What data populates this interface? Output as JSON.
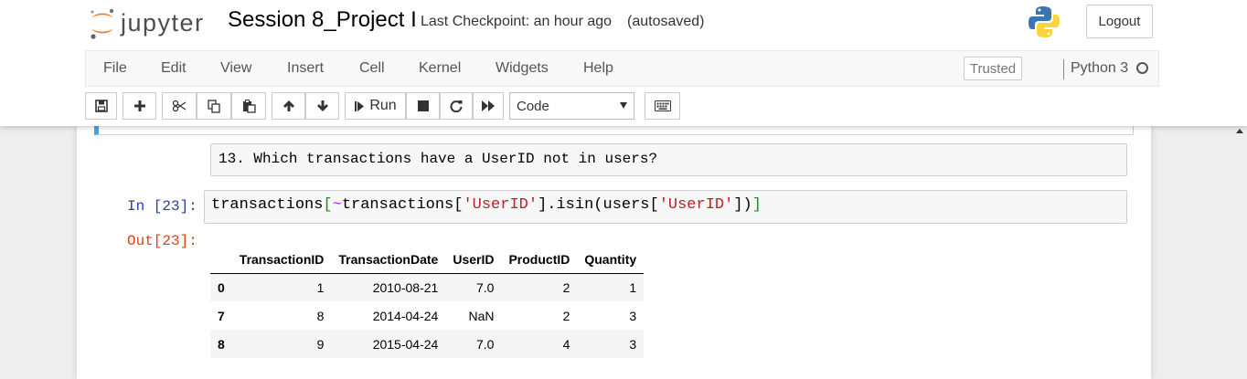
{
  "header": {
    "logo_text": "jupyter",
    "notebook_title": "Session 8_Project I",
    "checkpoint_text": "Last Checkpoint: an hour ago",
    "autosave_text": "(autosaved)",
    "logout_label": "Logout"
  },
  "menubar": {
    "items": [
      "File",
      "Edit",
      "View",
      "Insert",
      "Cell",
      "Kernel",
      "Widgets",
      "Help"
    ],
    "trusted_label": "Trusted",
    "kernel_name": "Python 3"
  },
  "toolbar": {
    "run_label": "Run",
    "cell_type": "Code",
    "icons": [
      "save-icon",
      "plus-icon",
      "cut-icon",
      "copy-icon",
      "paste-icon",
      "arrow-up-icon",
      "arrow-down-icon",
      "step-forward-icon",
      "stop-icon",
      "restart-icon",
      "fast-forward-icon",
      "keyboard-icon"
    ]
  },
  "cells": {
    "markdown_text": "13. Which transactions have a UserID not in users?",
    "in_prompt": "In [23]:",
    "code": {
      "t1": "transactions",
      "t2": "[",
      "t3": "~",
      "t4": "transactions[",
      "t5": "'UserID'",
      "t6": "].isin(users[",
      "t7": "'UserID'",
      "t8": "])",
      "t9": "]"
    },
    "out_prompt": "Out[23]:"
  },
  "dataframe": {
    "columns": [
      "",
      "TransactionID",
      "TransactionDate",
      "UserID",
      "ProductID",
      "Quantity"
    ],
    "rows": [
      [
        "0",
        "1",
        "2010-08-21",
        "7.0",
        "2",
        "1"
      ],
      [
        "7",
        "8",
        "2014-04-24",
        "NaN",
        "2",
        "3"
      ],
      [
        "8",
        "9",
        "2015-04-24",
        "7.0",
        "4",
        "3"
      ]
    ]
  },
  "colors": {
    "in_prompt": "#303f9f",
    "out_prompt": "#d84315",
    "selected_cell_border": "#42a5f5",
    "string_literal": "#ba2121"
  }
}
